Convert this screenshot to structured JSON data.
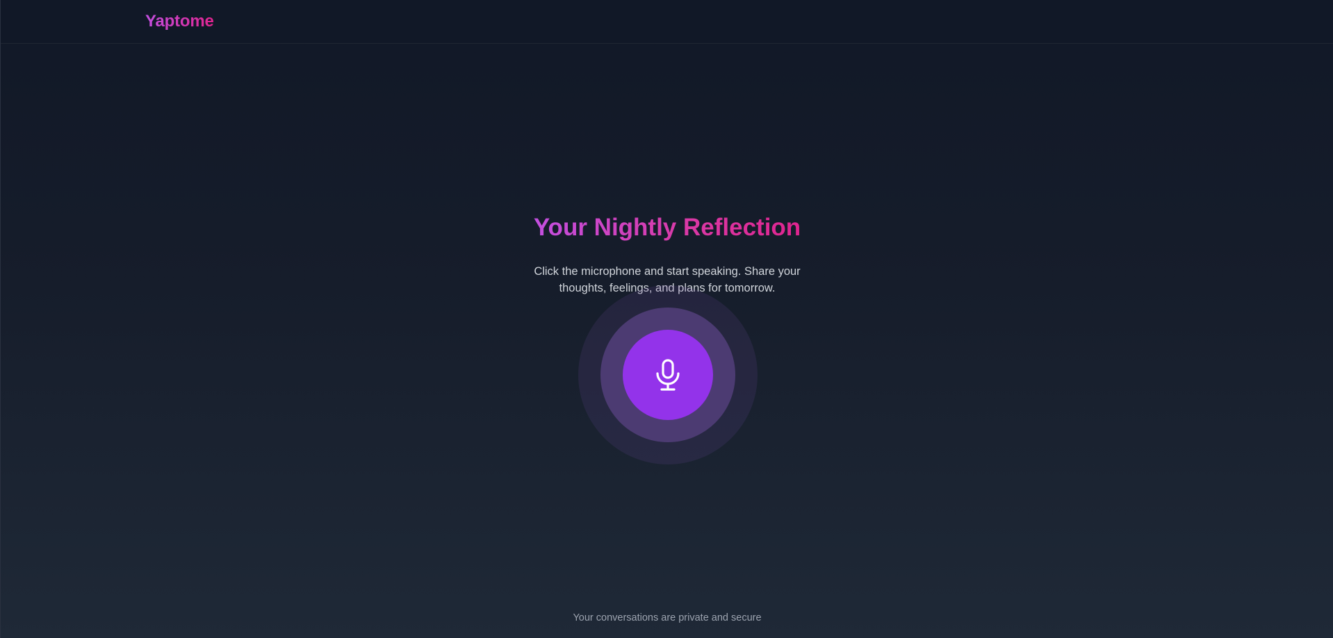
{
  "header": {
    "brand": "Yaptome"
  },
  "main": {
    "title": "Your Nightly Reflection",
    "subtitle": "Click the microphone and start speaking. Share your thoughts, feelings, and plans for tomorrow.",
    "mic_button": {
      "icon": "microphone-icon",
      "color": "#9333ea"
    }
  },
  "footer": {
    "text": "Your conversations are private and secure"
  },
  "colors": {
    "background_top": "#111827",
    "background_bottom": "#1f2937",
    "brand_gradient_start": "#c34fe0",
    "brand_gradient_end": "#e0248f",
    "accent": "#9333ea"
  }
}
